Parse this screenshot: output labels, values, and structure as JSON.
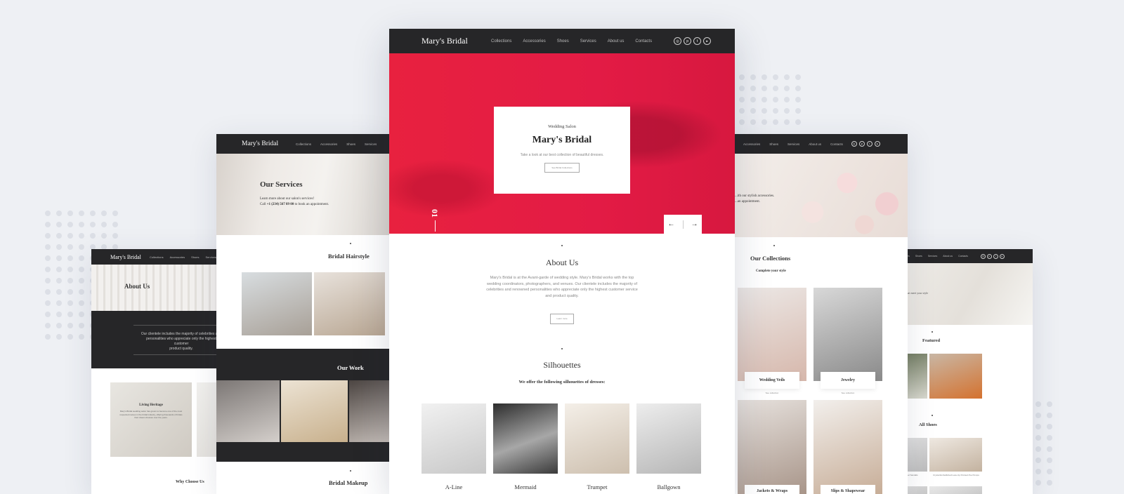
{
  "brand": "Mary's Bridal",
  "nav": [
    "Collections",
    "Accessories",
    "Shoes",
    "Services",
    "About us",
    "Contacts"
  ],
  "social_icons": [
    "instagram-icon",
    "pinterest-icon",
    "twitter-icon",
    "youtube-icon"
  ],
  "colors": {
    "accent": "#e31b45",
    "nav_bg": "#262628",
    "page_bg": "#eef0f4"
  },
  "main": {
    "hero": {
      "kicker": "Wedding Salon",
      "title": "Mary's Bridal",
      "text": "Take a look at our best collection of beautiful dresses.",
      "button": "See Bridal Collections",
      "slide_number": "01"
    },
    "about": {
      "title": "About Us",
      "text": "Mary's Bridal is at the Avant-garde of wedding style. Mary's Bridal works with the top wedding coordinators, photographers, and venues. Our clientele includes the majority of celebrities and renowned personalities who appreciate only the highest customer service and product quality.",
      "button": "Learn more"
    },
    "silhouettes": {
      "title": "Silhouettes",
      "subtitle": "We offer the following silhouettes of dresses:",
      "items": [
        "A-Line",
        "Mermaid",
        "Trumpet",
        "Ballgown"
      ]
    }
  },
  "services": {
    "nav": [
      "Collections",
      "Accessories",
      "Shoes",
      "Services"
    ],
    "hero_title": "Our Services",
    "hero_line1": "Learn more about our salon's services!",
    "hero_line2_prefix": "Call ",
    "hero_phone": "+1 (234) 567 89 00",
    "hero_line2_suffix": " to book an appointment.",
    "section1": "Bridal Hairstyle",
    "section2": "Our Work",
    "section3": "Bridal Makeup"
  },
  "about_page": {
    "nav": [
      "Collections",
      "Accessories",
      "Shoes",
      "Services"
    ],
    "hero_title": "About Us",
    "quote_line1": "Our clientele includes the majority of celebrities and",
    "quote_line2": "personalities who appreciate only the highest customer",
    "quote_line3": "product quality.",
    "card_title": "Living Heritage",
    "card_text": "Mary's Bridal wedding salon has grown to become one of the most respected names in the bridal industry, offering thousands of brides their dream dresses over the years.",
    "section": "Why Choose Us"
  },
  "collections_page": {
    "nav": [
      "Accessories",
      "Shoes",
      "Services",
      "About us",
      "Contacts"
    ],
    "hero_line1": "...ith our stylish accessories.",
    "hero_line2": "...an appointment.",
    "title": "Our Collections",
    "subtitle": "Complete your style",
    "items": [
      {
        "label": "Wedding Veils",
        "link": "See collection"
      },
      {
        "label": "Jewelry",
        "link": "See collection"
      },
      {
        "label": "Jackets & Wraps",
        "link": ""
      },
      {
        "label": "Slips & Shapewear",
        "link": ""
      }
    ]
  },
  "shoes_page": {
    "nav": [
      "Accessories",
      "Shoes",
      "Services",
      "About us",
      "Contacts"
    ],
    "hero_line1": "...set of wedding shoes that meet your style",
    "hero_line2": "requirements.",
    "featured": "Featured",
    "all": "All Shoes",
    "item1": "Crystal T-Strap Low Heel Sandals",
    "item2": "Crystal Embellished Lace-Up Pointed-Toe Pumps"
  }
}
